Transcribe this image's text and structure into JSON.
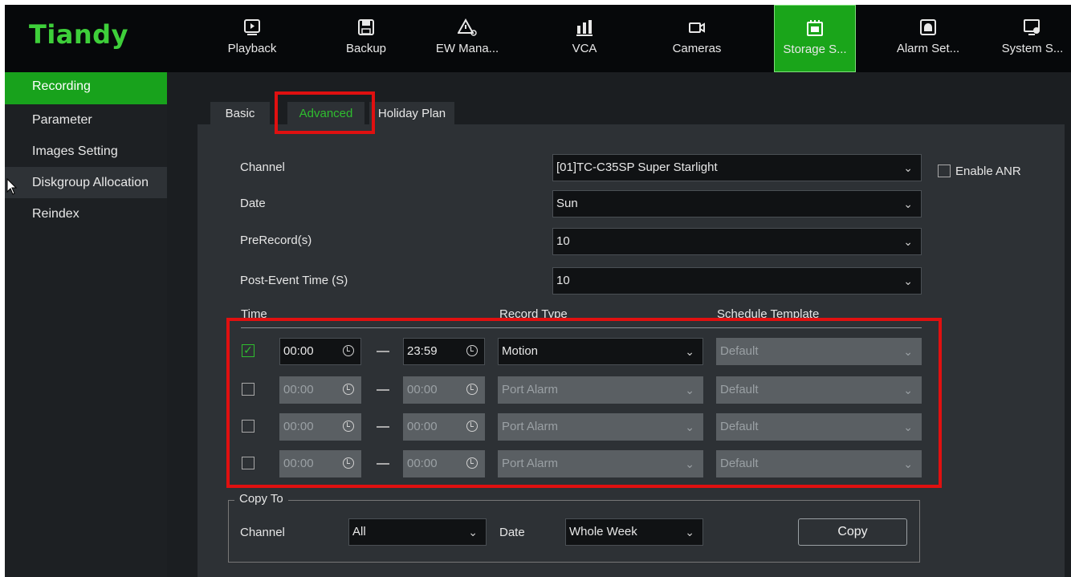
{
  "app": {
    "logo": "Tiandy"
  },
  "nav": [
    {
      "label": "Playback",
      "icon": "playback-icon"
    },
    {
      "label": "Backup",
      "icon": "backup-icon"
    },
    {
      "label": "EW Mana...",
      "icon": "warning-settings-icon"
    },
    {
      "label": "VCA",
      "icon": "vca-icon"
    },
    {
      "label": "Cameras",
      "icon": "camera-icon"
    },
    {
      "label": "Storage S...",
      "icon": "storage-icon",
      "active": true
    },
    {
      "label": "Alarm Set...",
      "icon": "alarm-icon"
    },
    {
      "label": "System S...",
      "icon": "system-settings-icon"
    }
  ],
  "sidebar": {
    "items": [
      {
        "label": "Recording"
      },
      {
        "label": "Parameter"
      },
      {
        "label": "Images Setting"
      },
      {
        "label": "Diskgroup Allocation"
      },
      {
        "label": "Reindex"
      }
    ]
  },
  "tabs": [
    {
      "label": "Basic"
    },
    {
      "label": "Advanced"
    },
    {
      "label": "Holiday Plan"
    }
  ],
  "form": {
    "channel_label": "Channel",
    "channel_value": "[01]TC-C35SP Super Starlight",
    "enable_anr_label": "Enable ANR",
    "date_label": "Date",
    "date_value": "Sun",
    "prerecord_label": "PreRecord(s)",
    "prerecord_value": "10",
    "postevent_label": "Post-Event Time (S)",
    "postevent_value": "10"
  },
  "schedule": {
    "col_time": "Time",
    "col_record_type": "Record Type",
    "col_template": "Schedule Template",
    "rows": [
      {
        "checked": true,
        "start": "00:00",
        "end": "23:59",
        "type": "Motion",
        "template": "Default"
      },
      {
        "checked": false,
        "start": "00:00",
        "end": "00:00",
        "type": "Port Alarm",
        "template": "Default"
      },
      {
        "checked": false,
        "start": "00:00",
        "end": "00:00",
        "type": "Port Alarm",
        "template": "Default"
      },
      {
        "checked": false,
        "start": "00:00",
        "end": "00:00",
        "type": "Port Alarm",
        "template": "Default"
      }
    ]
  },
  "copy_to": {
    "legend": "Copy To",
    "channel_label": "Channel",
    "channel_value": "All",
    "date_label": "Date",
    "date_value": "Whole Week",
    "copy_button": "Copy"
  },
  "colors": {
    "brand": "#3ecf3a",
    "active": "#18a21c",
    "highlight": "#e01010"
  }
}
